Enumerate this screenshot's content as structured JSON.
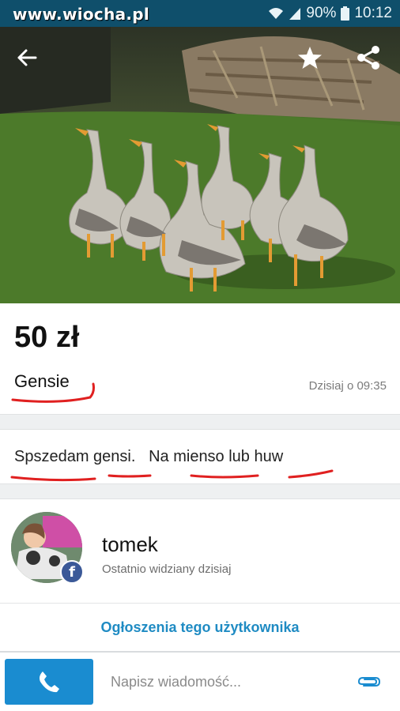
{
  "status_bar": {
    "watermark": "www.wiocha.pl",
    "battery": "90%",
    "time": "10:12",
    "icons": [
      "wifi-icon",
      "signal-icon",
      "battery-icon"
    ]
  },
  "hero": {
    "icons": [
      "arrow-back-icon",
      "star-icon",
      "share-icon"
    ]
  },
  "listing": {
    "price": "50 zł",
    "title": "Gensie",
    "date": "Dzisiaj o 09:35",
    "description": "Spszedam gensi.   Na mienso lub huw"
  },
  "seller": {
    "name": "tomek",
    "last_seen": "Ostatnio widziany dzisiaj",
    "badge": "f",
    "user_ads_link": "Ogłoszenia tego użytkownika"
  },
  "bottom_bar": {
    "message_placeholder": "Napisz wiadomość...",
    "icons": [
      "phone-icon",
      "paperclip-icon"
    ]
  },
  "colors": {
    "status_bar": "#0f4f6b",
    "accent": "#1a8cd0",
    "link": "#1f8bc3",
    "annotation_red": "#e02020"
  }
}
